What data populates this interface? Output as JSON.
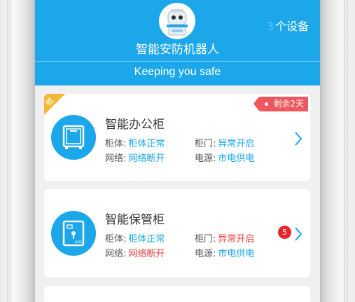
{
  "header": {
    "app_name": "智能安防机器人",
    "device_count": "3",
    "device_count_suffix": "个设备",
    "tagline": "Keeping you safe"
  },
  "colors": {
    "brand": "#1ba7ea",
    "normal": "#1ba7ea",
    "alert": "#ee3b3b",
    "corner": "#f3b733",
    "expire": "#f0565d"
  },
  "devices": [
    {
      "corner_tag": "租",
      "expire_label": "剩余2天",
      "name": "智能办公柜",
      "icon": "cabinet-icon",
      "body_label": "柜体:",
      "body_value": "柜体正常",
      "door_label": "柜门:",
      "door_value": "异常开启",
      "network_label": "网络:",
      "network_value": "网络断开",
      "power_label": "电源:",
      "power_value": "市电供电"
    },
    {
      "name": "智能保管柜",
      "icon": "safe-icon",
      "icon_text": "HISS",
      "badge": "5",
      "body_label": "柜体:",
      "body_value": "柜体正常",
      "door_label": "柜门:",
      "door_value": "异常开启",
      "network_label": "网络:",
      "network_value": "网络断开",
      "power_label": "电源:",
      "power_value": "市电供电"
    }
  ]
}
